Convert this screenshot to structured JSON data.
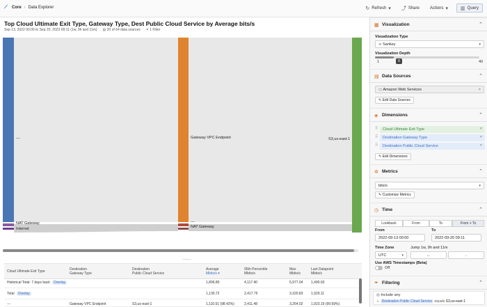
{
  "topbar": {
    "crumbs": [
      "Core",
      "Data Explorer"
    ],
    "separator": "›",
    "actions": {
      "refresh": "Refresh",
      "share": "Share",
      "actions": "Actions",
      "query": "Query"
    }
  },
  "main": {
    "title": "Top Cloud Ultimate Exit Type, Gateway Type, Dest Public Cloud Service by Average bits/s",
    "subtitle": {
      "range": "Sep 13, 2022 00:00 to Sep 20, 2022 09:11 (1w, 9h and 11m)",
      "sources": "20 of 64 data sources",
      "filters": "1 Filter"
    }
  },
  "chart_data": {
    "type": "sankey",
    "nodes": [
      {
        "label": "---",
        "color": "#4a77b4"
      },
      {
        "label": "NAT Gateway",
        "color": "#8a5aa0"
      },
      {
        "label": "Internet",
        "color": "#6b3f8f"
      },
      {
        "label": "Gateway VPC Endpoint",
        "color": "#e0832e"
      },
      {
        "label": "---",
        "color": "#b04a3a"
      },
      {
        "label": "NAT Gateway",
        "color": "#8a4a4a"
      },
      {
        "label": "S3,us-east-1",
        "color": "#6aa84f"
      }
    ],
    "colors": {
      "flow": "#e6e6e6",
      "flow_dark": "#cccccc"
    }
  },
  "table": {
    "columns": [
      {
        "label": "Cloud Ultimate Exit Type",
        "sub": ""
      },
      {
        "label": "Destination",
        "sub": "Gateway Type"
      },
      {
        "label": "Destination",
        "sub": "Public Cloud Service"
      },
      {
        "label": "Average",
        "sub": "Mbits/s"
      },
      {
        "label": "95th Percentile",
        "sub": "Mbits/s"
      },
      {
        "label": "Max",
        "sub": "Mbits/s"
      },
      {
        "label": "Last Datapoint",
        "sub": "Mbits/s"
      }
    ],
    "rows": [
      {
        "c1": "Historical Total: 7 days back",
        "pill": "Overlay",
        "c2": "",
        "c3": "",
        "avg": "1,896.80",
        "p95": "4,117.40",
        "max": "5,977.04",
        "last": "1,490.93"
      },
      {
        "c1": "Total",
        "pill": "Overlay",
        "c2": "",
        "c3": "",
        "avg": "1,130.72",
        "p95": "2,417.75",
        "max": "3,320.83",
        "last": "1,929.11"
      },
      {
        "c1": "---",
        "pill": "",
        "c2": "Gateway VPC Endpoint",
        "c3": "S3,us-east-1",
        "avg": "1,110.51 (98.42%)",
        "p95": "2,411.48",
        "max": "3,264.02",
        "last": "1,923.19 (99.69%)"
      }
    ]
  },
  "sidebar": {
    "visualization": {
      "title": "Visualization",
      "type_label": "Visualization Type",
      "type_value": "Sankey",
      "depth_label": "Visualization Depth",
      "depth_value": "8",
      "depth_min": "1",
      "depth_max": "40",
      "depth_fraction": 0.18
    },
    "data_sources": {
      "title": "Data Sources",
      "value": "Amazon Web Services",
      "edit": "Edit Data Sources"
    },
    "dimensions": {
      "title": "Dimensions",
      "items": [
        {
          "label": "Cloud Ultimate Exit Type",
          "color": "#e3f1e3"
        },
        {
          "label": "Destination Gateway Type",
          "color": "#e3ecf9"
        },
        {
          "label": "Destination Public Cloud Service",
          "color": "#e3ecf9"
        }
      ],
      "edit": "Edit Dimensions"
    },
    "metrics": {
      "title": "Metrics",
      "value": "bits/s",
      "customize": "Customize Metrics"
    },
    "time": {
      "title": "Time",
      "modes": [
        "Lookback",
        "From",
        "To",
        "From + To"
      ],
      "active_mode": "From + To",
      "from_label": "From",
      "from_value": "2022-09-13 00:00",
      "to_label": "To",
      "to_value": "2022-09-20 09:11",
      "tz_label": "Time Zone",
      "tz_value": "UTC",
      "jump_label": "Jump 1w, 9h and 11m",
      "aws_label": "Use AWS Timestamps (Beta)",
      "aws_value": "Off"
    },
    "filtering": {
      "title": "Filtering",
      "include": "Include any",
      "chip": "Destination Public Cloud Service",
      "op": "equals",
      "value": "S3,us-east-1"
    }
  }
}
